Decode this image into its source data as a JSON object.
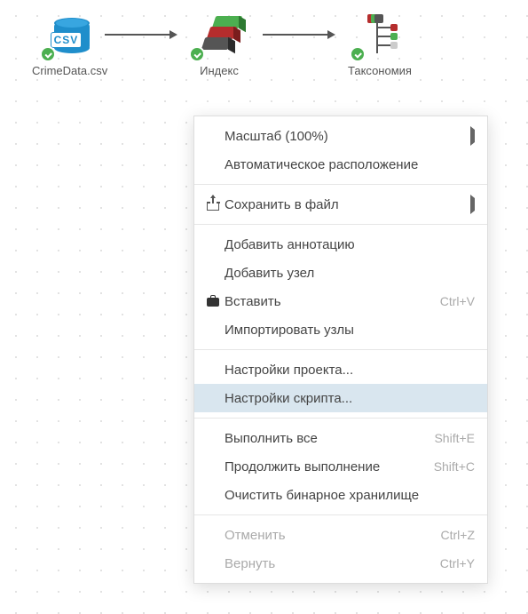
{
  "nodes": {
    "csv": {
      "label": "CrimeData.csv",
      "badge": "CSV"
    },
    "index": {
      "label": "Индекс"
    },
    "tax": {
      "label": "Таксономия"
    }
  },
  "menu": {
    "zoom": {
      "label": "Масштаб (100%)"
    },
    "autolayout": {
      "label": "Автоматическое расположение"
    },
    "save": {
      "label": "Сохранить в файл"
    },
    "add_annotation": {
      "label": "Добавить аннотацию"
    },
    "add_node": {
      "label": "Добавить узел"
    },
    "paste": {
      "label": "Вставить",
      "shortcut": "Ctrl+V"
    },
    "import_nodes": {
      "label": "Импортировать узлы"
    },
    "project_settings": {
      "label": "Настройки проекта..."
    },
    "script_settings": {
      "label": "Настройки скрипта..."
    },
    "run_all": {
      "label": "Выполнить все",
      "shortcut": "Shift+E"
    },
    "continue": {
      "label": "Продолжить выполнение",
      "shortcut": "Shift+C"
    },
    "clear_bin": {
      "label": "Очистить бинарное хранилище"
    },
    "undo": {
      "label": "Отменить",
      "shortcut": "Ctrl+Z"
    },
    "redo": {
      "label": "Вернуть",
      "shortcut": "Ctrl+Y"
    }
  }
}
